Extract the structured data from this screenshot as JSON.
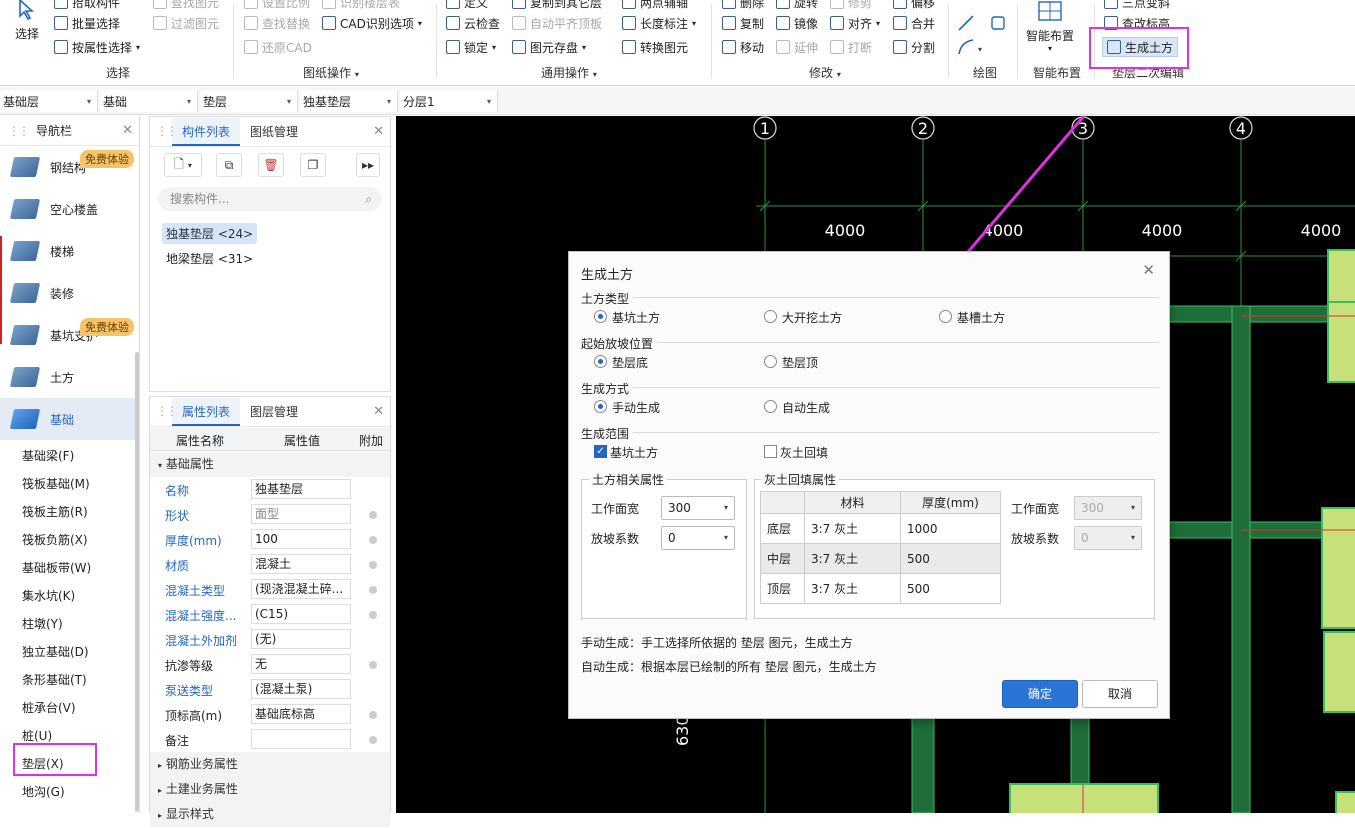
{
  "ribbon": {
    "select": {
      "big": "选择",
      "items": [
        "拾取构件",
        "批量选择",
        "按属性选择"
      ],
      "group": "选择"
    },
    "drawing": {
      "items": [
        "设置比例",
        "查找图元",
        "查找替换",
        "过滤图元",
        "还原CAD",
        "识别楼层表",
        "CAD识别选项"
      ],
      "group": "图纸操作"
    },
    "common": {
      "items": [
        "定义",
        "云检查",
        "锁定",
        "复制到其它层",
        "自动平齐顶板",
        "图元存盘",
        "两点辅轴",
        "长度标注",
        "转换图元"
      ],
      "group": "通用操作"
    },
    "modify": {
      "items": [
        "删除",
        "复制",
        "移动",
        "旋转",
        "镜像",
        "延伸",
        "修剪",
        "对齐",
        "打断",
        "偏移",
        "合并",
        "分割"
      ],
      "group": "修改"
    },
    "draw": {
      "group": "绘图"
    },
    "smart": {
      "big": "智能布置",
      "group": "智能布置"
    },
    "cushion": {
      "items": [
        "三点变斜",
        "查改标高",
        "生成土方"
      ],
      "group": "垫层二次编辑"
    }
  },
  "bar2": {
    "floor": "基础层",
    "category": "基础",
    "type": "垫层",
    "component": "独基垫层",
    "layer": "分层1"
  },
  "nav": {
    "title": "导航栏",
    "big": [
      {
        "label": "钢结构",
        "badge": "免费体验"
      },
      {
        "label": "空心楼盖"
      },
      {
        "label": "楼梯"
      },
      {
        "label": "装修"
      },
      {
        "label": "基坑支护",
        "badge": "免费体验"
      },
      {
        "label": "土方"
      },
      {
        "label": "基础"
      }
    ],
    "small": [
      "基础梁(F)",
      "筏板基础(M)",
      "筏板主筋(R)",
      "筏板负筋(X)",
      "基础板带(W)",
      "集水坑(K)",
      "柱墩(Y)",
      "独立基础(D)",
      "条形基础(T)",
      "桩承台(V)",
      "桩(U)",
      "垫层(X)",
      "地沟(G)"
    ]
  },
  "comp": {
    "tabs": [
      "构件列表",
      "图纸管理"
    ],
    "search_placeholder": "搜索构件...",
    "items": [
      "独基垫层 <24>",
      "地梁垫层 <31>"
    ]
  },
  "props": {
    "tabs": [
      "属性列表",
      "图层管理"
    ],
    "headers": [
      "属性名称",
      "属性值",
      "附加"
    ],
    "group_basic": "基础属性",
    "rows": [
      {
        "name": "名称",
        "value": "独基垫层"
      },
      {
        "name": "形状",
        "value": "面型"
      },
      {
        "name": "厚度(mm)",
        "value": "100"
      },
      {
        "name": "材质",
        "value": "混凝土"
      },
      {
        "name": "混凝土类型",
        "value": "(现浇混凝土碎..."
      },
      {
        "name": "混凝土强度...",
        "value": "(C15)"
      },
      {
        "name": "混凝土外加剂",
        "value": "(无)"
      },
      {
        "name": "抗渗等级",
        "value": "无"
      },
      {
        "name": "泵送类型",
        "value": "(混凝土泵)"
      },
      {
        "name": "顶标高(m)",
        "value": "基础底标高"
      },
      {
        "name": "备注",
        "value": ""
      }
    ],
    "groups_more": [
      "钢筋业务属性",
      "土建业务属性",
      "显示样式"
    ]
  },
  "canvas": {
    "axes": [
      "1",
      "2",
      "3",
      "4"
    ],
    "dims": [
      "4000",
      "4000",
      "4000",
      "4000"
    ],
    "side_dim": "630"
  },
  "dialog": {
    "title": "生成土方",
    "sec_type": "土方类型",
    "type_opts": [
      "基坑土方",
      "大开挖土方",
      "基槽土方"
    ],
    "sec_slope": "起始放坡位置",
    "slope_opts": [
      "垫层底",
      "垫层顶"
    ],
    "sec_mode": "生成方式",
    "mode_opts": [
      "手动生成",
      "自动生成"
    ],
    "sec_range": "生成范围",
    "range_opts": [
      "基坑土方",
      "灰土回填"
    ],
    "earth_title": "土方相关属性",
    "earth_width_label": "工作面宽",
    "earth_width": "300",
    "earth_slope_label": "放坡系数",
    "earth_slope": "0",
    "lime_title": "灰土回填属性",
    "lime_headers": [
      "材料",
      "厚度(mm)"
    ],
    "lime_rows": [
      {
        "layer": "底层",
        "material": "3:7 灰土",
        "thickness": "1000"
      },
      {
        "layer": "中层",
        "material": "3:7 灰土",
        "thickness": "500"
      },
      {
        "layer": "顶层",
        "material": "3:7 灰土",
        "thickness": "500"
      }
    ],
    "lime_width_label": "工作面宽",
    "lime_width": "300",
    "lime_slope_label": "放坡系数",
    "lime_slope": "0",
    "note_manual": "手动生成：手工选择所依据的 垫层 图元，生成土方",
    "note_auto": "自动生成：根据本层已绘制的所有 垫层 图元，生成土方",
    "ok": "确定",
    "cancel": "取消"
  },
  "colors": {
    "accent": "#2466c4",
    "highlight": "#e030e0",
    "pad": "#c6e07a",
    "wall": "#1f6e3a"
  }
}
